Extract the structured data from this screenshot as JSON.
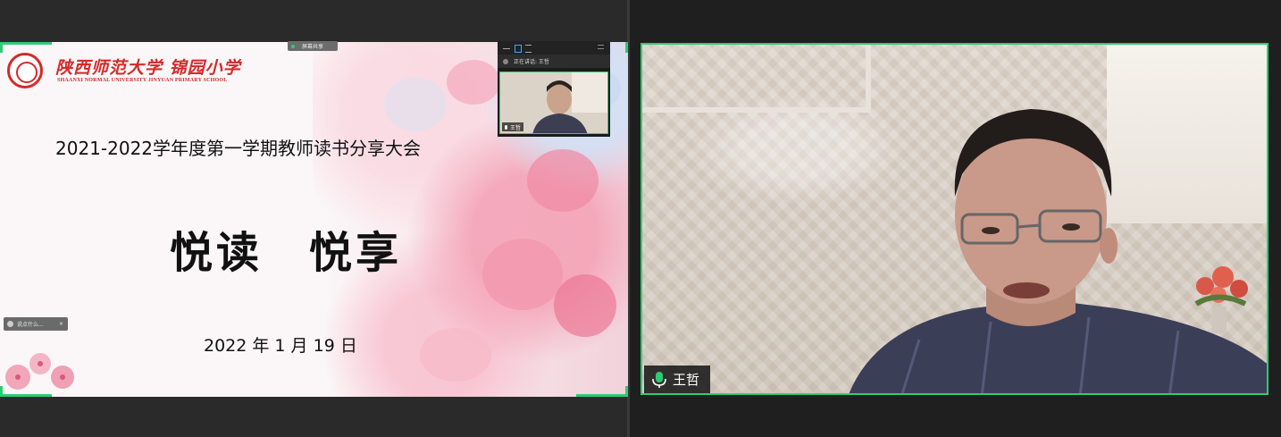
{
  "shared_slide": {
    "school_name_cn": "陕西师范大学 锦园小学",
    "school_name_en": "SHAANXI NORMAL UNIVERSITY JINYUAN PRIMARY SCHOOL",
    "heading": "2021-2022学年度第一学期教师读书分享大会",
    "title": "悦读　悦享",
    "date": "2022 年 1 月 19 日"
  },
  "floating_toolbar": {
    "label": "屏幕共享"
  },
  "mini_panel": {
    "header": "正在讲话: 王哲",
    "participant_name": "王哲"
  },
  "small_chip": {
    "label": "说点什么...",
    "close": "×"
  },
  "video_tile": {
    "participant_name": "王哲"
  },
  "colors": {
    "active_border": "#2ecc71",
    "school_red": "#d42a2a",
    "background": "#262626"
  }
}
